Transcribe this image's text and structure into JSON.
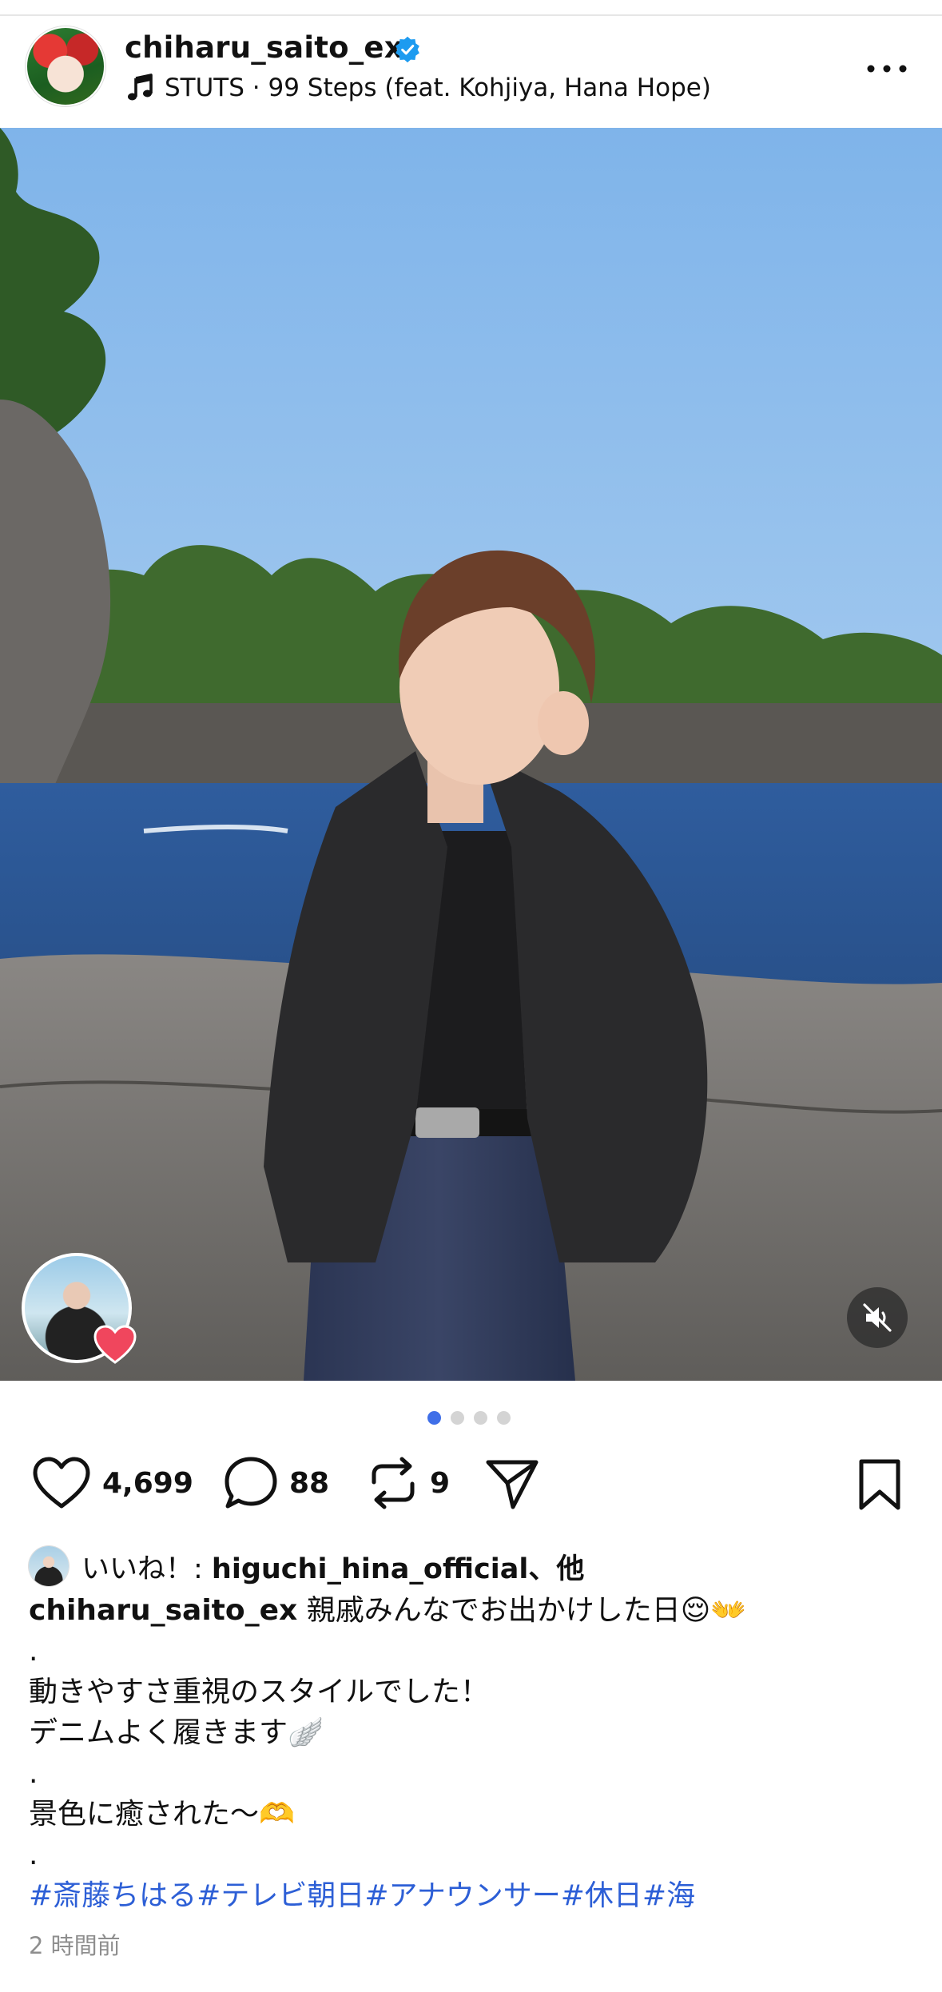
{
  "header": {
    "username": "chiharu_saito_ex",
    "music": "STUTS · 99 Steps (feat. Kohjiya, Hana Hope)"
  },
  "carousel": {
    "total": 4,
    "active_index": 0
  },
  "actions": {
    "likes_count": "4,699",
    "comments_count": "88",
    "reposts_count": "9"
  },
  "likes": {
    "prefix": "いいね！: ",
    "user": "higuchi_hina_official",
    "suffix": "、他"
  },
  "caption": {
    "user": "chiharu_saito_ex",
    "line1": "親戚みんなでお出かけした日😌👐",
    "dot1": ".",
    "line2": "動きやすさ重視のスタイルでした！",
    "line3": "デニムよく履きます🪽",
    "dot2": ".",
    "line4": "景色に癒された〜🫶",
    "dot3": ".",
    "hashtags": "#斎藤ちはる#テレビ朝日#アナウンサー#休日#海"
  },
  "timestamp": "2 時間前",
  "colors": {
    "accent": "#3f6fe8",
    "hashtag": "#2d5fd6",
    "verified": "#1d9bf0"
  }
}
